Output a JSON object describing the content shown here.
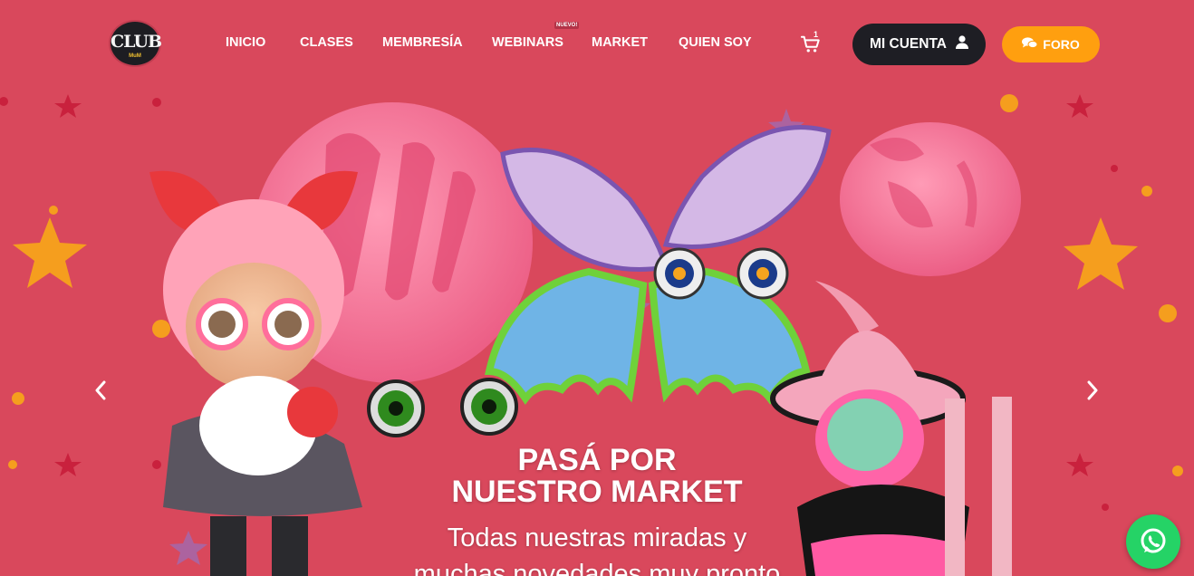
{
  "brand": {
    "logo_text": "CLUB",
    "logo_subtext": "MuM"
  },
  "nav": {
    "items": [
      "INICIO",
      "CLASES",
      "MEMBRESÍA",
      "WEBINARS",
      "MARKET",
      "QUIEN SOY"
    ],
    "new_badge": "NUEVO!"
  },
  "cart": {
    "count": "1",
    "icon": "cart-icon"
  },
  "account_button": {
    "label": "MI CUENTA",
    "icon": "user-icon"
  },
  "forum_button": {
    "label": "FORO",
    "icon": "chat-icon"
  },
  "hero": {
    "headline_line1": "PASÁ POR",
    "headline_line2": "NUESTRO MARKET",
    "subtitle_line1": "Todas nuestras miradas y",
    "subtitle_line2": "muchas novedades muy pronto",
    "prev_icon": "chevron-left-icon",
    "next_icon": "chevron-right-icon"
  },
  "whatsapp": {
    "icon": "whatsapp-icon"
  },
  "colors": {
    "background": "#d9485c",
    "account_button": "#1e1e24",
    "forum_button": "#ff9f0f",
    "whatsapp": "#25d366",
    "star": "#f59e1e",
    "mold_pink": "#f06a8f"
  }
}
